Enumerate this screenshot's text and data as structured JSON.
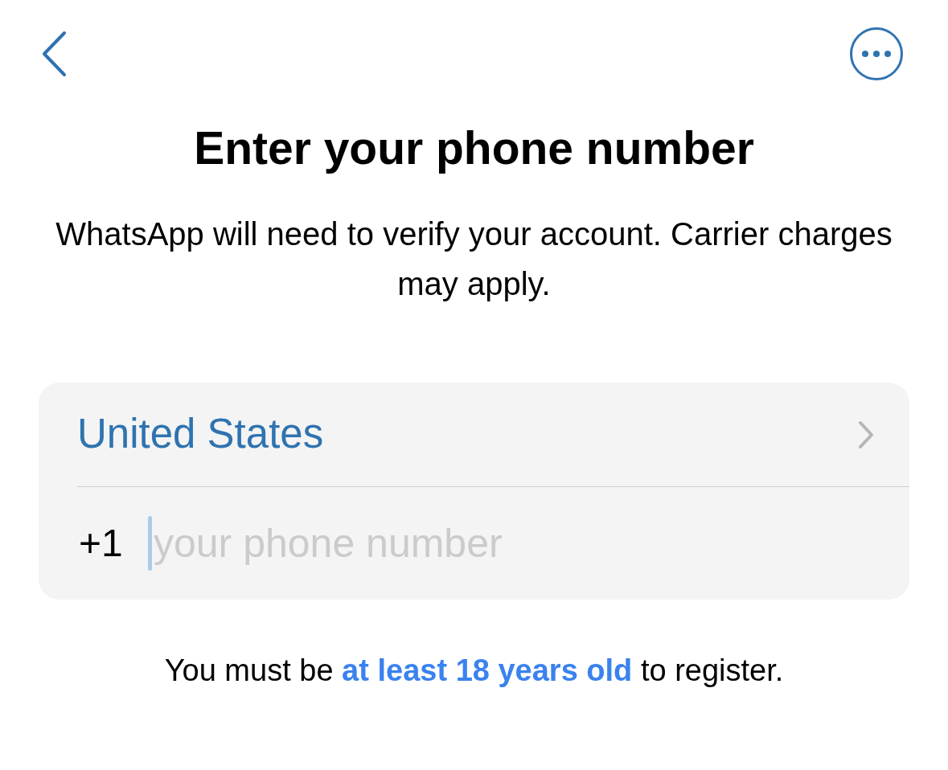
{
  "title": "Enter your phone number",
  "subtitle": "WhatsApp will need to verify your account. Carrier charges may apply.",
  "country": {
    "name": "United States"
  },
  "phone": {
    "code": "+1",
    "placeholder": "your phone number",
    "focused": true
  },
  "footer": {
    "before": "You must be",
    "link": "at least 18 years old",
    "after": "to register."
  }
}
